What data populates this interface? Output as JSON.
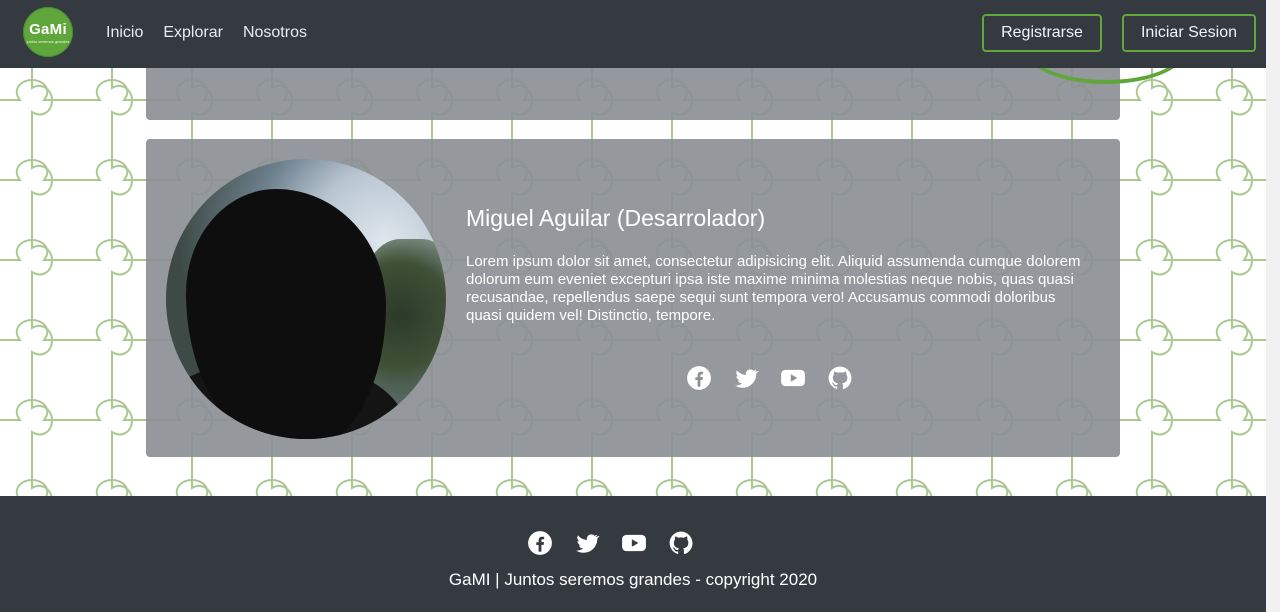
{
  "brand": {
    "logo_text": "GaMi",
    "logo_subtext": "juntos seremos grandes"
  },
  "nav": {
    "links": [
      "Inicio",
      "Explorar",
      "Nosotros"
    ],
    "register_label": "Registrarse",
    "login_label": "Iniciar Sesion"
  },
  "profile_card": {
    "name": "Miguel Aguilar (Desarrolador)",
    "description": "Lorem ipsum dolor sit amet, consectetur adipisicing elit. Aliquid assumenda cumque dolorem dolorum eum eveniet excepturi ipsa iste maxime minima molestias neque nobis, quas quasi recusandae, repellendus saepe sequi sunt tempora vero! Accusamus commodi doloribus quasi quidem vel! Distinctio, tempore.",
    "social_icons": [
      "facebook-icon",
      "twitter-icon",
      "youtube-icon",
      "github-icon"
    ]
  },
  "footer": {
    "social_icons": [
      "facebook-icon",
      "twitter-icon",
      "youtube-icon",
      "github-icon"
    ],
    "text": "GaMI | Juntos seremos grandes - copyright 2020"
  },
  "colors": {
    "navbar_bg": "#343a40",
    "accent_green": "#5fa63b",
    "card_bg": "#8c8f94",
    "puzzle_line": "#a9c98f"
  }
}
